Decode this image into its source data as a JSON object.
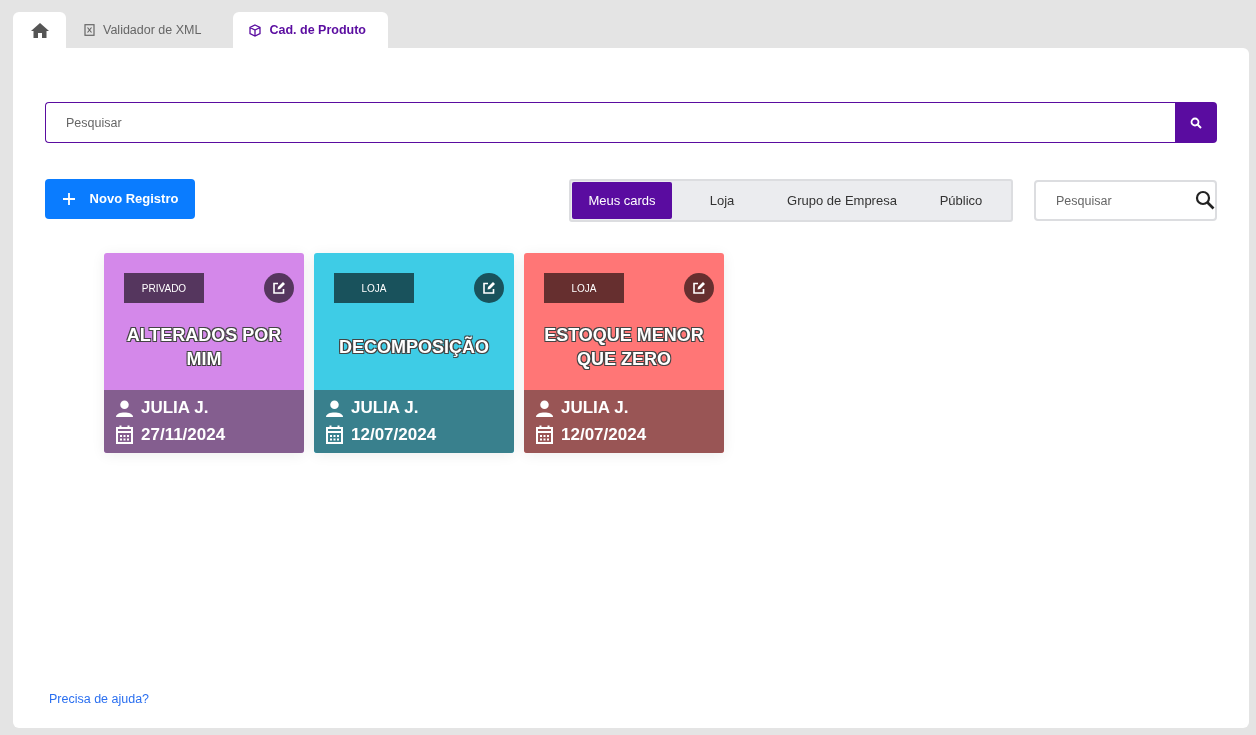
{
  "tabs": [
    {
      "kind": "home",
      "selected": false
    },
    {
      "kind": "file",
      "label": "Validador de XML",
      "selected": false
    },
    {
      "kind": "cube",
      "label": "Cad. de Produto",
      "selected": true
    }
  ],
  "search": {
    "placeholder": "Pesquisar"
  },
  "new_button": {
    "label": "Novo Registro"
  },
  "filters": [
    {
      "label": "Meus cards",
      "selected": true
    },
    {
      "label": "Loja",
      "selected": false
    },
    {
      "label": "Grupo de Empresa",
      "selected": false
    },
    {
      "label": "Público",
      "selected": false
    }
  ],
  "filter_search": {
    "placeholder": "Pesquisar"
  },
  "cards": [
    {
      "tag": "PRIVADO",
      "title": "ALTERADOS POR MIM",
      "user": "JULIA J.",
      "date": "27/11/2024",
      "color": "#d488ea"
    },
    {
      "tag": "LOJA",
      "title": "DECOMPOSIÇÃO",
      "user": "JULIA J.",
      "date": "12/07/2024",
      "color": "#3ecce6"
    },
    {
      "tag": "LOJA",
      "title": "ESTOQUE MENOR QUE ZERO",
      "user": "JULIA J.",
      "date": "12/07/2024",
      "color": "#ff7676"
    }
  ],
  "help_link": "Precisa de ajuda?"
}
